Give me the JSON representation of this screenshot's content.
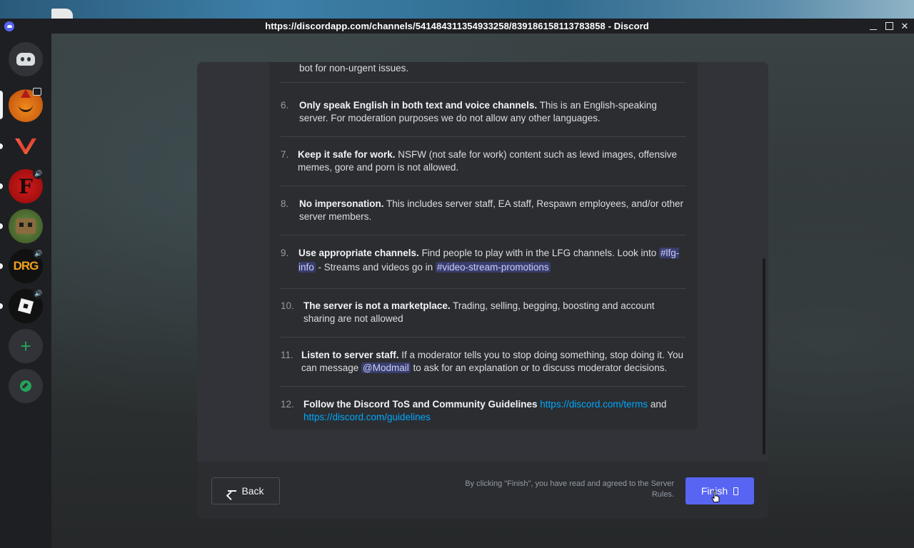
{
  "window": {
    "title": "https://discordapp.com/channels/541484311354933258/839186158113783858 - Discord"
  },
  "server_rail": {
    "items": [
      {
        "name": "home",
        "icon": "discord-logo-icon"
      },
      {
        "name": "pumpkin-server",
        "icon": "pumpkin-icon",
        "badge_icon": "calendar-icon"
      },
      {
        "name": "valorant-server",
        "icon": "valorant-icon"
      },
      {
        "name": "f-server",
        "icon": "f-logo-icon",
        "badge_icon": "speaker-icon"
      },
      {
        "name": "creeper-server",
        "icon": "creeper-icon"
      },
      {
        "name": "drg-server",
        "icon": "drg-logo-icon",
        "label": "DRG",
        "badge_icon": "speaker-icon"
      },
      {
        "name": "roblox-server",
        "icon": "roblox-icon",
        "badge_icon": "speaker-icon"
      },
      {
        "name": "add-server",
        "icon": "plus-icon",
        "label": "+"
      },
      {
        "name": "explore-servers",
        "icon": "compass-icon"
      }
    ]
  },
  "rules": {
    "partial_top": "bot for non-urgent issues.",
    "items": [
      {
        "num": "6.",
        "title": "Only speak English in both text and voice channels.",
        "text": " This is an English-speaking server. For moderation purposes we do not allow any other languages."
      },
      {
        "num": "7.",
        "title": "Keep it safe for work.",
        "text": " NSFW (not safe for work) content such as lewd images, offensive memes, gore and porn is not allowed."
      },
      {
        "num": "8.",
        "title": "No impersonation.",
        "text": " This includes server staff, EA staff, Respawn employees, and/or other server members."
      },
      {
        "num": "9.",
        "title": "Use appropriate channels.",
        "text_a": " Find people to play with in the LFG channels. Look into ",
        "channel_a": "#lfg-info",
        "text_b": " - Streams and videos go in ",
        "channel_b": "#video-stream-promotions"
      },
      {
        "num": "10.",
        "title": "The server is not a marketplace.",
        "text": " Trading, selling, begging, boosting and account sharing are not allowed"
      },
      {
        "num": "11.",
        "title": "Listen to server staff.",
        "text_a": " If a moderator tells you to stop doing something, stop doing it. You can message ",
        "mention": "@Modmail",
        "text_b": " to ask for an explanation or to discuss moderator decisions."
      },
      {
        "num": "12.",
        "title": "Follow the Discord ToS and Community Guidelines",
        "link_a": "https://discord.com/terms",
        "text": " and ",
        "link_b": "https://discord.com/guidelines"
      }
    ]
  },
  "footer": {
    "back_label": "Back",
    "agree_text": "By clicking \"Finish\", you have read and agreed to the Server Rules.",
    "finish_label": "Finish"
  },
  "colors": {
    "accent": "#5865f2",
    "link": "#00a8fc",
    "background": "#1e1f22",
    "modal": "#313338"
  }
}
